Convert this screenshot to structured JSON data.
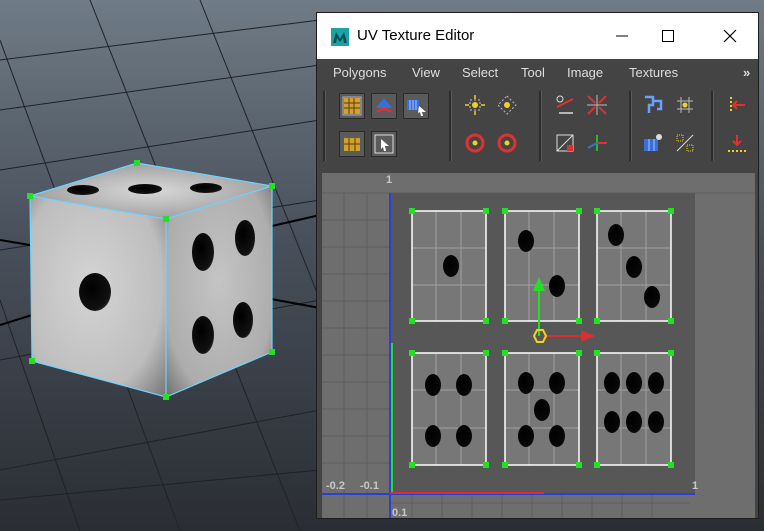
{
  "window": {
    "title": "UV Texture Editor"
  },
  "menu": {
    "items": [
      "Polygons",
      "View",
      "Select",
      "Tool",
      "Image",
      "Textures"
    ],
    "overflow": "»"
  },
  "toolbar": {
    "row1": [
      "uv-grid-icon",
      "rotate-uv-icon",
      "move-uv-icon",
      "snap-icon",
      "align-icon",
      "cut-uv-icon",
      "sew-uv-icon",
      "unfold-icon",
      "layout-icon",
      "flip-icon"
    ],
    "row2": [
      "uv-shell-icon",
      "select-icon",
      "ring-red-icon",
      "ring-red-2-icon",
      "diagonal-icon",
      "axis-icon",
      "uv-move-icon",
      "grid-sort-icon",
      "normalize-icon"
    ]
  },
  "uv_axis": {
    "top_label": "1",
    "left_labels": [
      "-0.2",
      "-0.1"
    ],
    "right_label": "1",
    "bottom_label": "0.1"
  },
  "colors": {
    "accent_green": "#22e022",
    "axis_blue": "#2a3fd8",
    "axis_red": "#d83030",
    "wire_cyan": "#6ed3ff",
    "viewport_bg": "#3c4049"
  }
}
